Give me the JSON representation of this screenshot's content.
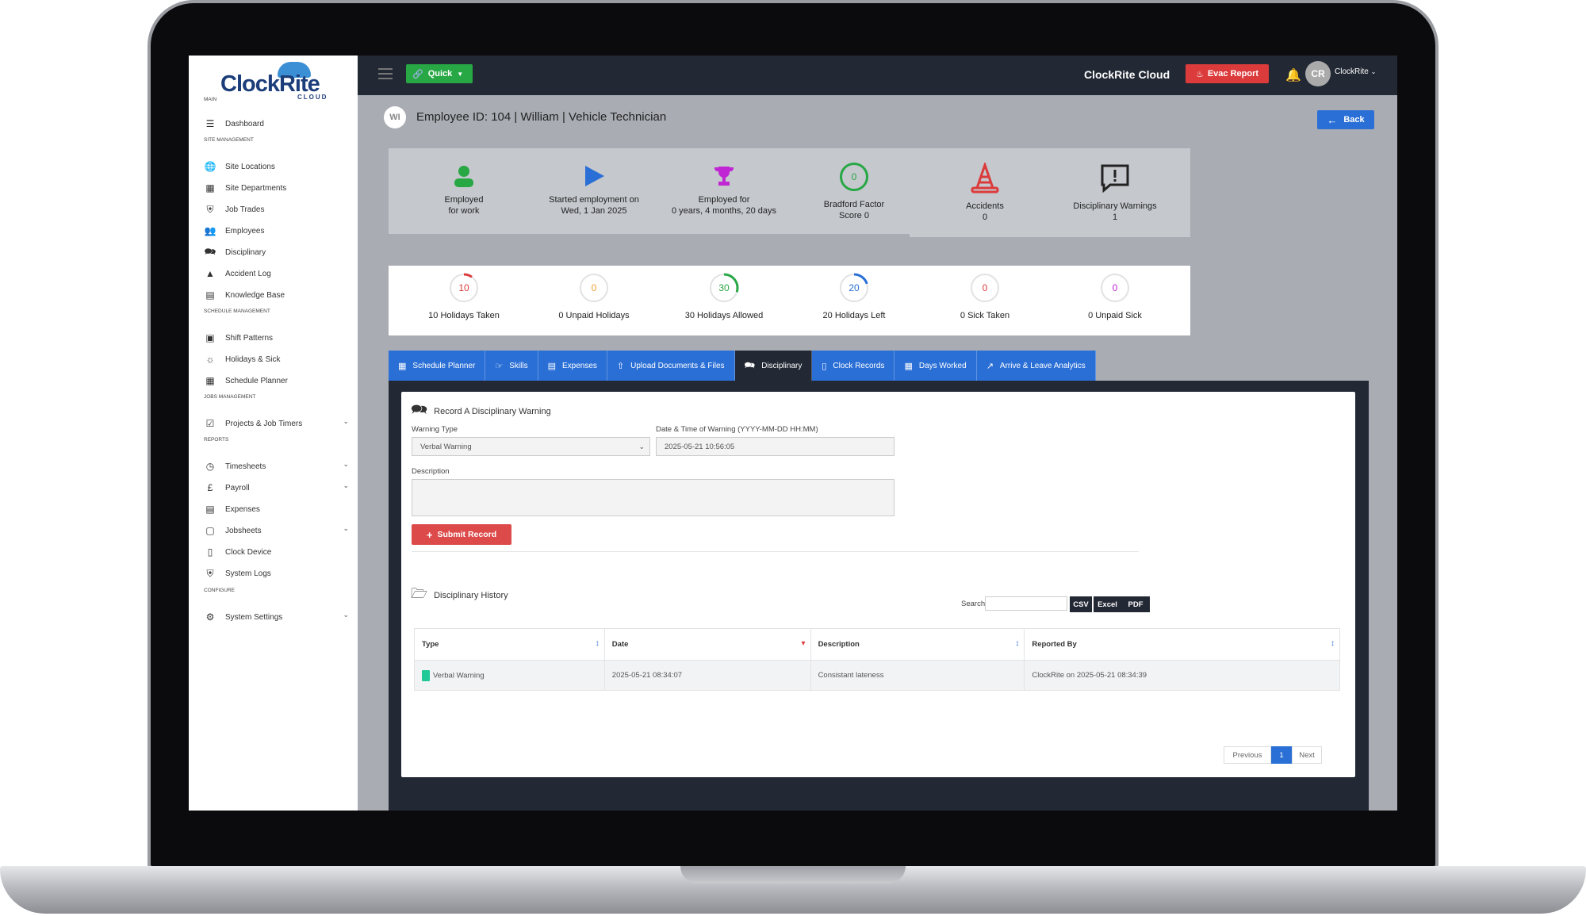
{
  "app": {
    "brand": "ClockRite",
    "brand_sub": "CLOUD",
    "top_title": "ClockRite Cloud",
    "quick_label": "Quick",
    "evac_label": "Evac Report",
    "user_initials": "CR",
    "user_name": "ClockRite"
  },
  "sidebar": {
    "sections": [
      {
        "title": "MAIN",
        "items": [
          {
            "label": "Dashboard",
            "icon": "sliders-icon"
          }
        ]
      },
      {
        "title": "SITE MANAGEMENT",
        "items": [
          {
            "label": "Site Locations",
            "icon": "globe-icon"
          },
          {
            "label": "Site Departments",
            "icon": "grid-icon"
          },
          {
            "label": "Job Trades",
            "icon": "shield-check-icon"
          },
          {
            "label": "Employees",
            "icon": "users-icon"
          },
          {
            "label": "Disciplinary",
            "icon": "message-alert-icon"
          },
          {
            "label": "Accident Log",
            "icon": "cone-icon"
          },
          {
            "label": "Knowledge Base",
            "icon": "book-icon"
          }
        ]
      },
      {
        "title": "SCHEDULE MANAGEMENT",
        "items": [
          {
            "label": "Shift Patterns",
            "icon": "clipboard-icon"
          },
          {
            "label": "Holidays & Sick",
            "icon": "sun-icon"
          },
          {
            "label": "Schedule Planner",
            "icon": "calendar-icon"
          }
        ]
      },
      {
        "title": "JOBS MANAGEMENT",
        "items": [
          {
            "label": "Projects & Job Timers",
            "icon": "checkbox-icon"
          }
        ]
      },
      {
        "title": "REPORTS",
        "items": [
          {
            "label": "Timesheets",
            "icon": "clock-icon"
          },
          {
            "label": "Payroll",
            "icon": "pound-icon"
          },
          {
            "label": "Expenses",
            "icon": "receipt-icon"
          },
          {
            "label": "Jobsheets",
            "icon": "box-icon"
          },
          {
            "label": "Clock Device",
            "icon": "tablet-icon"
          },
          {
            "label": "System Logs",
            "icon": "shield-icon"
          }
        ]
      },
      {
        "title": "CONFIGURE",
        "items": [
          {
            "label": "System Settings",
            "icon": "gear-icon"
          }
        ]
      }
    ]
  },
  "employee": {
    "initials": "WI",
    "title": "Employee ID: 104 | William | Vehicle Technician",
    "back_label": "Back"
  },
  "stat_cards": [
    {
      "line1": "Employed",
      "line2": "for work",
      "icon": "user-icon",
      "color": "#28a745"
    },
    {
      "line1": "Started employment on",
      "line2": "Wed, 1 Jan 2025",
      "icon": "play-icon",
      "color": "#2a6fd6"
    },
    {
      "line1": "Employed for",
      "line2": "0 years, 4 months, 20 days",
      "icon": "trophy-icon",
      "color": "#c026d3"
    },
    {
      "line1": "Bradford Factor",
      "line2": "Score 0",
      "value": "0",
      "icon": "ring-icon",
      "color": "#28a745"
    },
    {
      "line1": "Accidents",
      "line2": "0",
      "icon": "cone-icon",
      "color": "#dc3b3b"
    },
    {
      "line1": "Disciplinary Warnings",
      "line2": "1",
      "icon": "message-alert-icon",
      "color": "#222"
    }
  ],
  "holiday_cards": [
    {
      "value": "10",
      "label": "10 Holidays Taken",
      "color": "#dc3b3b",
      "fraction": 0.1
    },
    {
      "value": "0",
      "label": "0 Unpaid Holidays",
      "color": "#f0a030",
      "fraction": 0
    },
    {
      "value": "30",
      "label": "30 Holidays Allowed",
      "color": "#28a745",
      "fraction": 0.3
    },
    {
      "value": "20",
      "label": "20 Holidays Left",
      "color": "#2a6fd6",
      "fraction": 0.2
    },
    {
      "value": "0",
      "label": "0 Sick Taken",
      "color": "#dc3b3b",
      "fraction": 0
    },
    {
      "value": "0",
      "label": "0 Unpaid Sick",
      "color": "#c026d3",
      "fraction": 0
    }
  ],
  "tabs": [
    {
      "label": "Schedule Planner",
      "icon": "calendar-icon"
    },
    {
      "label": "Skills",
      "icon": "skills-icon"
    },
    {
      "label": "Expenses",
      "icon": "receipt-icon"
    },
    {
      "label": "Upload Documents & Files",
      "icon": "upload-icon"
    },
    {
      "label": "Disciplinary",
      "icon": "message-alert-icon",
      "active": true
    },
    {
      "label": "Clock Records",
      "icon": "tablet-icon"
    },
    {
      "label": "Days Worked",
      "icon": "calendar-icon"
    },
    {
      "label": "Arrive & Leave Analytics",
      "icon": "chart-line-icon"
    }
  ],
  "form": {
    "title": "Record A Disciplinary Warning",
    "warning_type_label": "Warning Type",
    "warning_type_value": "Verbal Warning",
    "date_label": "Date & Time of Warning (YYYY-MM-DD HH:MM)",
    "date_value": "2025-05-21 10:56:05",
    "description_label": "Description",
    "submit_label": "Submit Record"
  },
  "history": {
    "title": "Disciplinary History",
    "search_label": "Search:",
    "export": [
      "CSV",
      "Excel",
      "PDF"
    ],
    "columns": [
      "Type",
      "Date",
      "Description",
      "Reported By"
    ],
    "rows": [
      {
        "type": "Verbal Warning",
        "date": "2025-05-21 08:34:07",
        "description": "Consistant lateness",
        "reported_by": "ClockRite on 2025-05-21 08:34:39",
        "color": "#20c997"
      }
    ],
    "pagination": {
      "prev": "Previous",
      "page": "1",
      "next": "Next"
    }
  }
}
